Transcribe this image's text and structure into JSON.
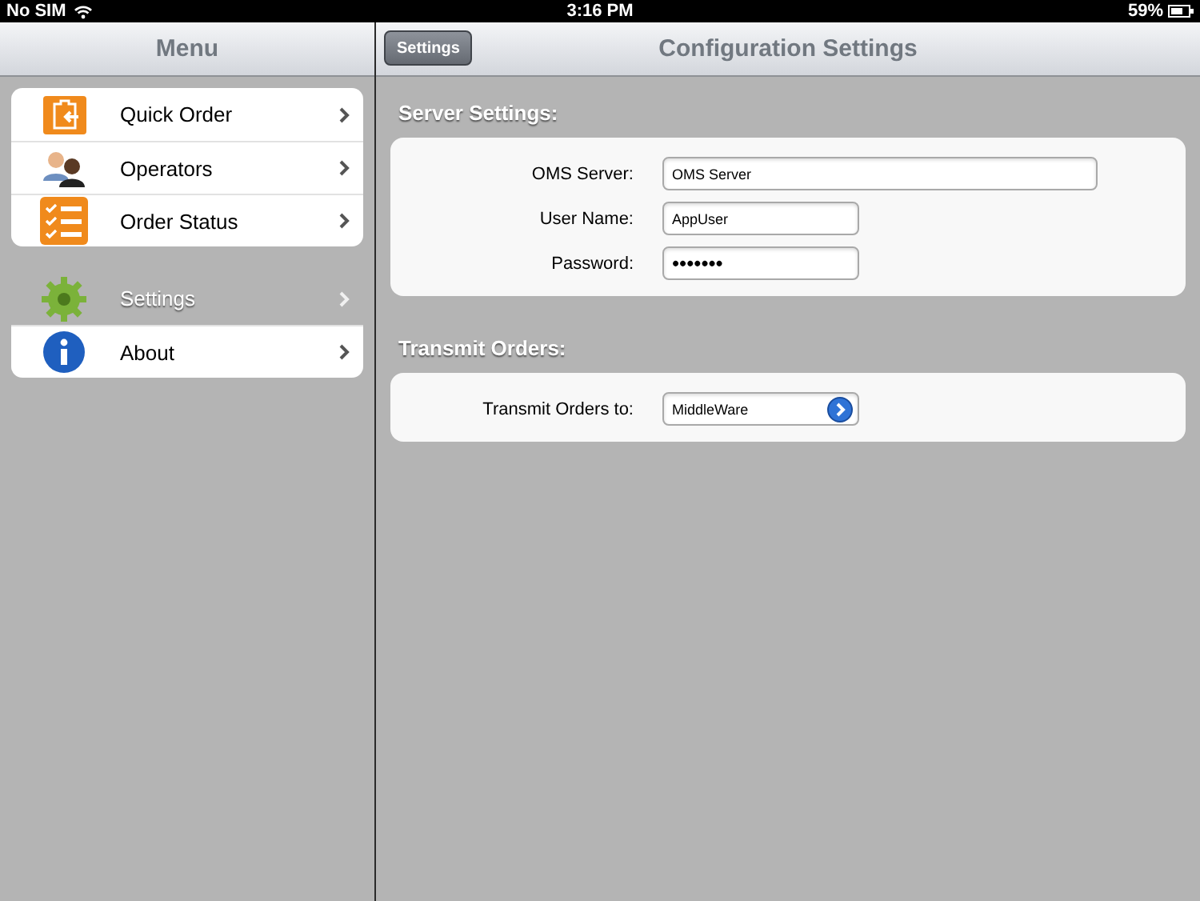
{
  "status_bar": {
    "carrier": "No SIM",
    "time": "3:16 PM",
    "battery": "59%"
  },
  "sidebar": {
    "title": "Menu",
    "groups": [
      {
        "items": [
          {
            "label": "Quick Order",
            "selected": false
          },
          {
            "label": "Operators",
            "selected": false
          },
          {
            "label": "Order Status",
            "selected": false
          }
        ]
      },
      {
        "items": [
          {
            "label": "Settings",
            "selected": true
          },
          {
            "label": "About",
            "selected": false
          }
        ]
      }
    ]
  },
  "detail": {
    "back_button": "Settings",
    "title": "Configuration Settings",
    "sections": [
      {
        "header": "Server Settings:",
        "fields": [
          {
            "kind": "text",
            "label": "OMS Server:",
            "value": "OMS Server",
            "wide": true
          },
          {
            "kind": "text",
            "label": "User Name:",
            "value": "AppUser",
            "wide": false
          },
          {
            "kind": "password",
            "label": "Password:",
            "value": "•••••••",
            "wide": false
          }
        ]
      },
      {
        "header": "Transmit Orders:",
        "fields": [
          {
            "kind": "picker",
            "label": "Transmit Orders to:",
            "value": "MiddleWare",
            "wide": false
          }
        ]
      }
    ]
  }
}
